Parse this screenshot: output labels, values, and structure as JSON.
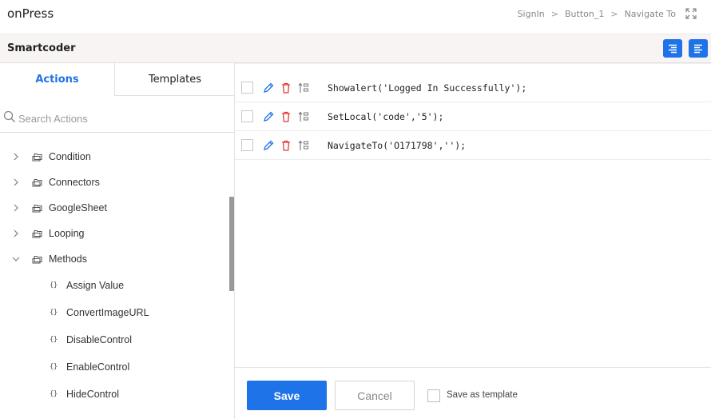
{
  "app": {
    "title": "onPress"
  },
  "breadcrumb": {
    "items": [
      "SignIn",
      "Button_1",
      "Navigate To"
    ],
    "separator": ">"
  },
  "header": {
    "title": "Smartcoder"
  },
  "tabs": [
    {
      "label": "Actions",
      "active": true
    },
    {
      "label": "Templates",
      "active": false
    }
  ],
  "search": {
    "placeholder": "Search Actions"
  },
  "tree": {
    "folders": [
      {
        "label": "Condition",
        "expanded": false
      },
      {
        "label": "Connectors",
        "expanded": false
      },
      {
        "label": "GoogleSheet",
        "expanded": false
      },
      {
        "label": "Looping",
        "expanded": false
      },
      {
        "label": "Methods",
        "expanded": true
      }
    ],
    "methods": [
      {
        "glyph": "{}",
        "label": "Assign Value"
      },
      {
        "glyph": "{}",
        "label": "ConvertImageURL"
      },
      {
        "glyph": "{}",
        "label": "DisableControl"
      },
      {
        "glyph": "{}",
        "label": "EnableControl"
      },
      {
        "glyph": "{}",
        "label": "HideControl"
      }
    ]
  },
  "code_lines": [
    "Showalert('Logged In Successfully');",
    "SetLocal('code','5');",
    "NavigateTo('O171798','');"
  ],
  "footer": {
    "save_label": "Save",
    "cancel_label": "Cancel",
    "template_label": "Save as template"
  },
  "colors": {
    "accent": "#1e73e8",
    "delete": "#e53935",
    "edit": "#1e73e8"
  }
}
